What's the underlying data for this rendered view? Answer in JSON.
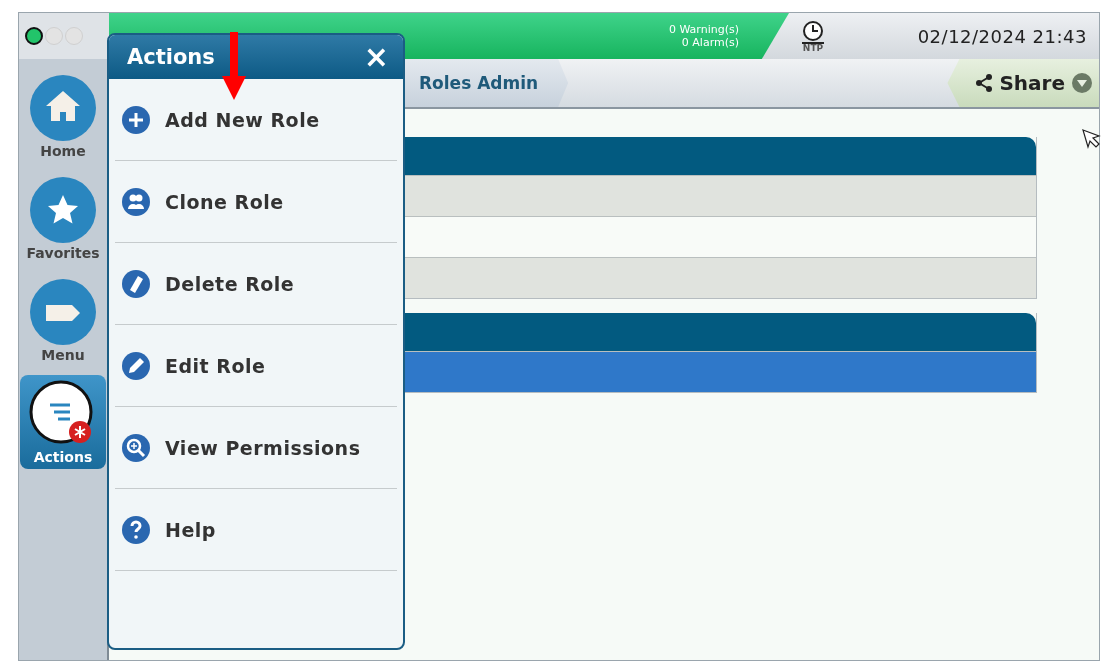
{
  "status_lights": [
    {
      "on": true
    },
    {
      "on": false
    },
    {
      "on": false
    }
  ],
  "status_bar": {
    "warnings": "0 Warning(s)",
    "alarms": "0 Alarm(s)",
    "clock_label": "NTP",
    "datetime": "02/12/2024 21:43"
  },
  "breadcrumb": {
    "current": "Roles Admin",
    "share": "Share"
  },
  "sidebar": {
    "items": [
      {
        "label": "Home",
        "kind": "home",
        "selected": false
      },
      {
        "label": "Favorites",
        "kind": "favorites",
        "selected": false
      },
      {
        "label": "Menu",
        "kind": "menu",
        "selected": false
      },
      {
        "label": "Actions",
        "kind": "actions",
        "selected": true
      }
    ]
  },
  "panels": [
    {
      "rows": [
        {
          "selected": false
        },
        {
          "selected": false
        },
        {
          "selected": false
        }
      ]
    },
    {
      "rows": [
        {
          "selected": true
        }
      ]
    }
  ],
  "actions_popup": {
    "title": "Actions",
    "close": "×",
    "items": [
      {
        "label": "Add New Role",
        "kind": "add"
      },
      {
        "label": "Clone Role",
        "kind": "clone"
      },
      {
        "label": "Delete Role",
        "kind": "delete"
      },
      {
        "label": "Edit Role",
        "kind": "edit"
      },
      {
        "label": "View Permissions",
        "kind": "view"
      },
      {
        "label": "Help",
        "kind": "help"
      }
    ]
  }
}
